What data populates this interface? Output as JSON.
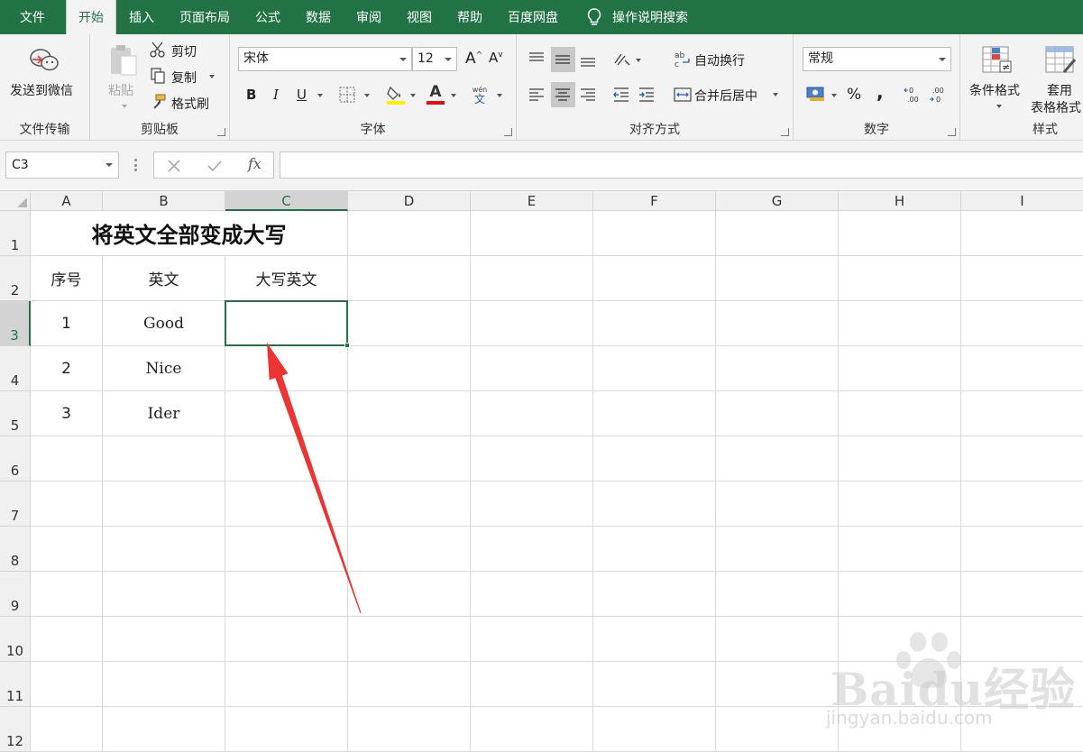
{
  "tabs": [
    "文件",
    "开始",
    "插入",
    "页面布局",
    "公式",
    "数据",
    "审阅",
    "视图",
    "帮助",
    "百度网盘"
  ],
  "active_tab": "开始",
  "tell_me": "操作说明搜索",
  "ribbon": {
    "group_file": {
      "label": "文件传输",
      "send_wechat": "发送到微信"
    },
    "group_clipboard": {
      "label": "剪贴板",
      "paste": "粘贴",
      "cut": "剪切",
      "copy": "复制",
      "format_painter": "格式刷"
    },
    "group_font": {
      "label": "字体",
      "font_name": "宋体",
      "font_size": "12",
      "bold": "B",
      "italic": "I",
      "underline": "U",
      "font_color_glyph": "A",
      "phonetic": "wén",
      "phonetic_sub": "文",
      "increase": "A",
      "decrease": "A"
    },
    "group_align": {
      "label": "对齐方式",
      "wrap": "自动换行",
      "merge": "合并后居中"
    },
    "group_number": {
      "label": "数字",
      "format": "常规",
      "percent": "%",
      "comma": ","
    },
    "group_style": {
      "label": "样式",
      "conditional": "条件格式",
      "table_format_1": "套用",
      "table_format_2": "表格格式"
    }
  },
  "formula_bar": {
    "name_box": "C3",
    "fx": "fx",
    "content": ""
  },
  "columns": [
    "A",
    "B",
    "C",
    "D",
    "E",
    "F",
    "G",
    "H",
    "I"
  ],
  "rows": [
    "1",
    "2",
    "3",
    "4",
    "5",
    "6",
    "7",
    "8",
    "9",
    "10",
    "11",
    "12"
  ],
  "sheet": {
    "title": "将英文全部变成大写",
    "headers": [
      "序号",
      "英文",
      "大写英文"
    ],
    "data": [
      [
        "1",
        "Good",
        ""
      ],
      [
        "2",
        "Nice",
        ""
      ],
      [
        "3",
        "Ider",
        ""
      ]
    ]
  },
  "selected_cell": "C3",
  "annotation_color": "#ee3333",
  "accent_color": "#217346",
  "watermark": {
    "text": "Baidu经验",
    "sub": "jingyan.baidu.com"
  }
}
